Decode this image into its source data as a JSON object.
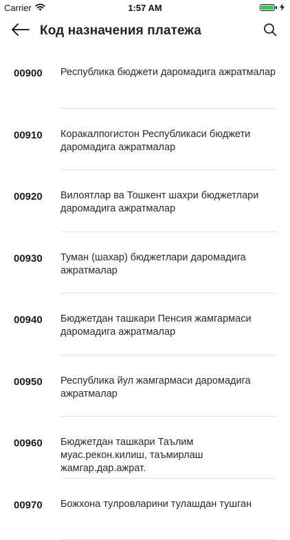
{
  "status_bar": {
    "carrier": "Carrier",
    "time": "1:57 AM",
    "battery_fill": 1.0
  },
  "nav": {
    "title": "Код назначения платежа"
  },
  "items": [
    {
      "code": "00900",
      "description": "Республика бюджети даромадига ажратмалар"
    },
    {
      "code": "00910",
      "description": "Коракалпогистон Республикаси бюджети даромадига ажратмалар"
    },
    {
      "code": "00920",
      "description": "Вилоятлар ва Тошкент шахри бюджетлари даромадига ажратмалар"
    },
    {
      "code": "00930",
      "description": "Туман (шахар) бюджетлари даромадига ажратмалар"
    },
    {
      "code": "00940",
      "description": "Бюджетдан ташкари Пенсия жамгармаси даромадига ажратмалар"
    },
    {
      "code": "00950",
      "description": "Республика йул жамгармаси даромадига ажратмалар"
    },
    {
      "code": "00960",
      "description": "Бюджетдан ташкари Таълим муас.рекон.килиш, таъмирлаш жамгар.дар.ажрат."
    },
    {
      "code": "00970",
      "description": "Божхона тулровларини тулашдан тушган"
    }
  ]
}
